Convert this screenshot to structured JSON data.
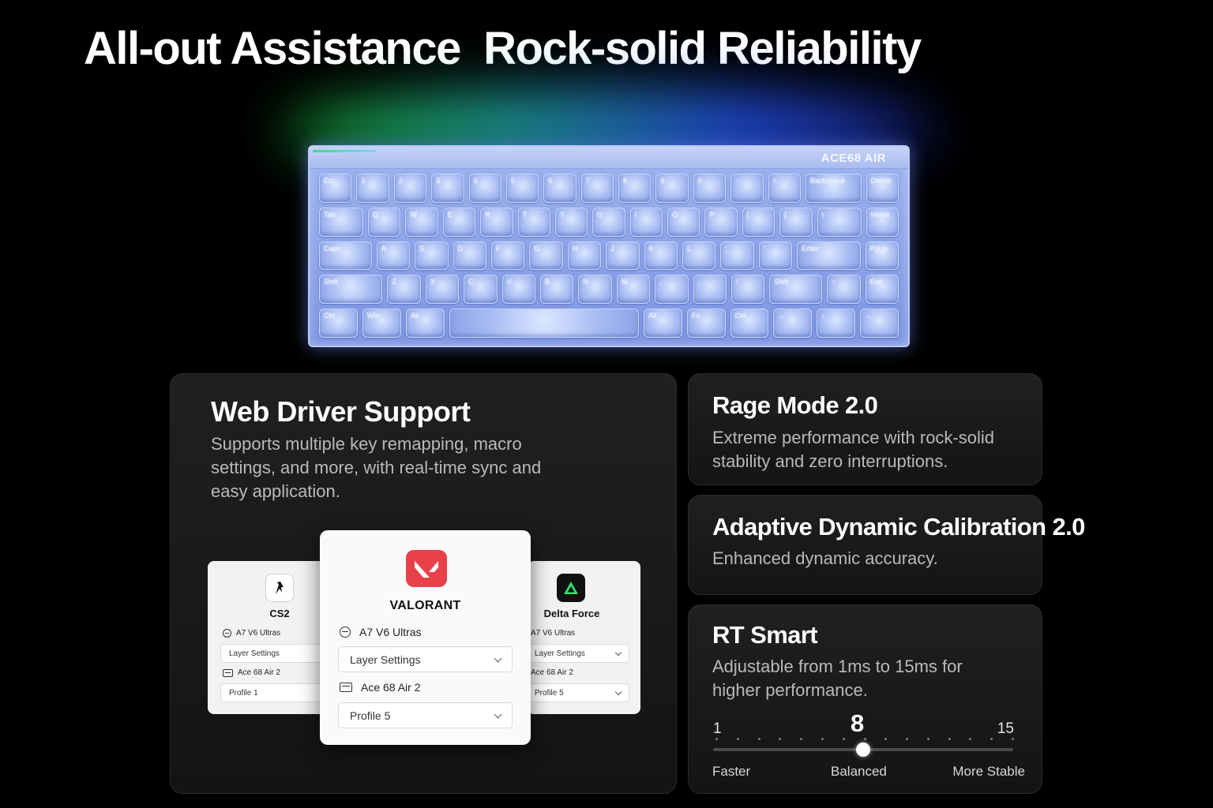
{
  "headline": "All-out Assistance  Rock-solid Reliability",
  "keyboard": {
    "brand": "ACE68 AIR",
    "rows": [
      [
        "Esc",
        "1",
        "2",
        "3",
        "4",
        "5",
        "6",
        "7",
        "8",
        "9",
        "0",
        "-",
        "=",
        "Backspace",
        "Delete"
      ],
      [
        "Tab",
        "Q",
        "W",
        "E",
        "R",
        "T",
        "Y",
        "U",
        "I",
        "O",
        "P",
        "[",
        "]",
        "\\",
        "Home"
      ],
      [
        "Caps",
        "A",
        "S",
        "D",
        "F",
        "G",
        "H",
        "J",
        "K",
        "L",
        ";",
        "'",
        "Enter",
        "PgUp"
      ],
      [
        "Shift",
        "Z",
        "X",
        "C",
        "V",
        "B",
        "N",
        "M",
        ",",
        ".",
        "/",
        "Shift",
        "↑",
        "End"
      ],
      [
        "Ctrl",
        "Win",
        "Alt",
        "",
        "Alt",
        "Fn",
        "Ctrl",
        "←",
        "↓",
        "→"
      ]
    ]
  },
  "web_driver": {
    "title": "Web Driver Support",
    "description": "Supports multiple key remapping, macro settings, and more, with real-time sync and easy application."
  },
  "panels": {
    "cs2": {
      "name": "CS2",
      "icon": "cs2-logo-icon",
      "device_1": "A7 V6 Ultras",
      "select_1": "Layer Settings",
      "device_2": "Ace 68 Air 2",
      "select_2": "Profile 1"
    },
    "valorant": {
      "name": "VALORANT",
      "icon": "valorant-logo-icon",
      "device_1": "A7 V6 Ultras",
      "select_1": "Layer Settings",
      "device_2": "Ace 68 Air 2",
      "select_2": "Profile 5"
    },
    "delta_force": {
      "name": "Delta Force",
      "icon": "delta-force-logo-icon",
      "device_1": "A7 V6 Ultras",
      "select_1": "Layer Settings",
      "device_2": "Ace 68 Air 2",
      "select_2": "Profile 5"
    }
  },
  "rage_mode": {
    "title": "Rage Mode 2.0",
    "description": "Extreme performance with rock-solid stability and zero interruptions."
  },
  "adc": {
    "title": "Adaptive Dynamic Calibration 2.0",
    "description": "Enhanced dynamic accuracy."
  },
  "rt_smart": {
    "title": "RT Smart",
    "description": "Adjustable from 1ms to 15ms for higher performance.",
    "slider": {
      "min": "1",
      "max": "15",
      "value": "8",
      "label_left": "Faster",
      "label_mid": "Balanced",
      "label_right": "More Stable"
    }
  },
  "colors": {
    "background": "#000000",
    "card": "#1a1a1a",
    "valorant_red": "#e8414b",
    "delta_green": "#2ee06b",
    "keyboard_blue": "#8fa6ea"
  }
}
